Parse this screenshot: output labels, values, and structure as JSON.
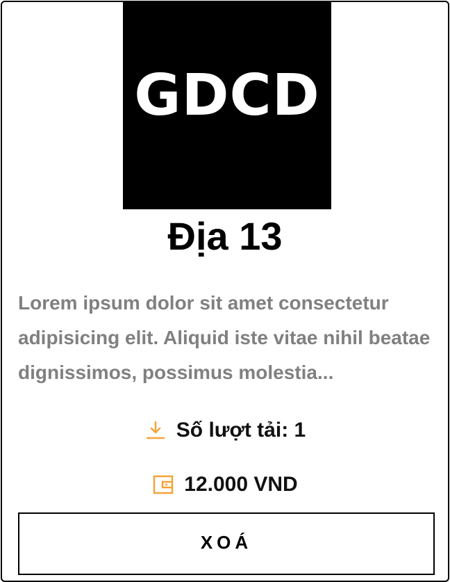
{
  "card": {
    "thumbnail_text": "GDCD",
    "title": "Địa 13",
    "description": "Lorem ipsum dolor sit amet consectetur adipisicing elit. Aliquid iste vitae nihil beatae dignissimos, possimus molestia...",
    "downloads_text": "Số lượt tải: 1",
    "price_text": "12.000 VND",
    "delete_label": "XOÁ"
  },
  "icons": {
    "downloads": "download-icon",
    "price": "wallet-icon"
  },
  "colors": {
    "accent": "#f5a33a",
    "description": "#808080",
    "thumbnail_bg": "#000000",
    "border": "#000000"
  }
}
